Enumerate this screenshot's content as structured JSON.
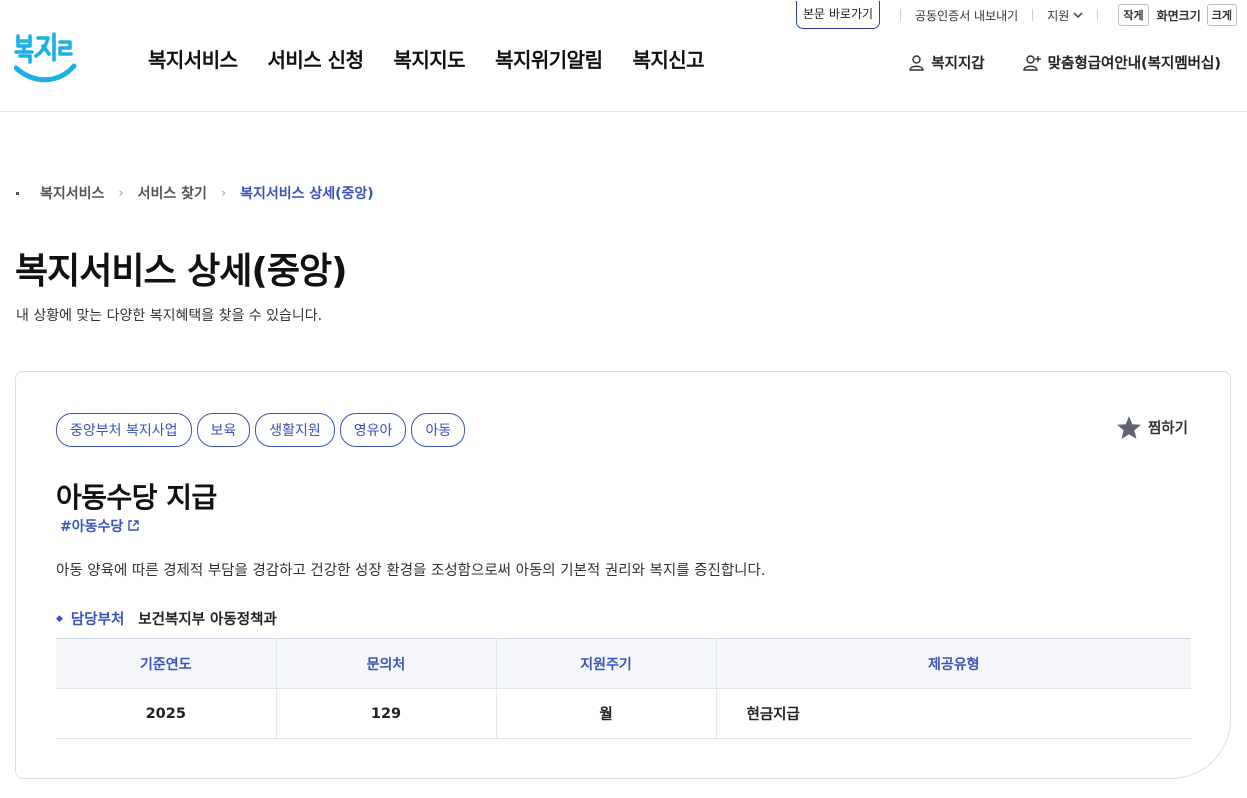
{
  "utility": {
    "skip_link": "본문 바로가기",
    "cert_export": "공동인증서 내보내기",
    "support": "지원",
    "font_small": "작게",
    "font_label": "화면크기",
    "font_large": "크게"
  },
  "header": {
    "nav": [
      "복지서비스",
      "서비스 신청",
      "복지지도",
      "복지위기알림",
      "복지신고"
    ],
    "wallet_link": "복지지갑",
    "membership_link": "맞춤형급여안내(복지멤버십)"
  },
  "breadcrumb": {
    "items": [
      "복지서비스",
      "서비스 찾기"
    ],
    "current": "복지서비스 상세(중앙)"
  },
  "page": {
    "title": "복지서비스 상세(중앙)",
    "description": "내 상황에 맞는 다양한 복지혜택을 찾을 수 있습니다."
  },
  "service": {
    "tags": [
      "중앙부처 복지사업",
      "보육",
      "생활지원",
      "영유아",
      "아동"
    ],
    "favorite_label": "찜하기",
    "title": "아동수당 지급",
    "hashtag": "#아동수당",
    "description": "아동 양육에 따른 경제적 부담을 경감하고 건강한 성장 환경을 조성함으로써 아동의 기본적 권리와 복지를 증진합니다.",
    "dept_label": "담당부처",
    "dept_value": "보건복지부 아동정책과",
    "table": {
      "headers": [
        "기준연도",
        "문의처",
        "지원주기",
        "제공유형"
      ],
      "row": [
        "2025",
        "129",
        "월",
        "현금지급"
      ]
    }
  },
  "colors": {
    "accent": "#3b53b8",
    "logo_cyan": "#1cb0e6",
    "header_bg": "#f4f6fa"
  }
}
